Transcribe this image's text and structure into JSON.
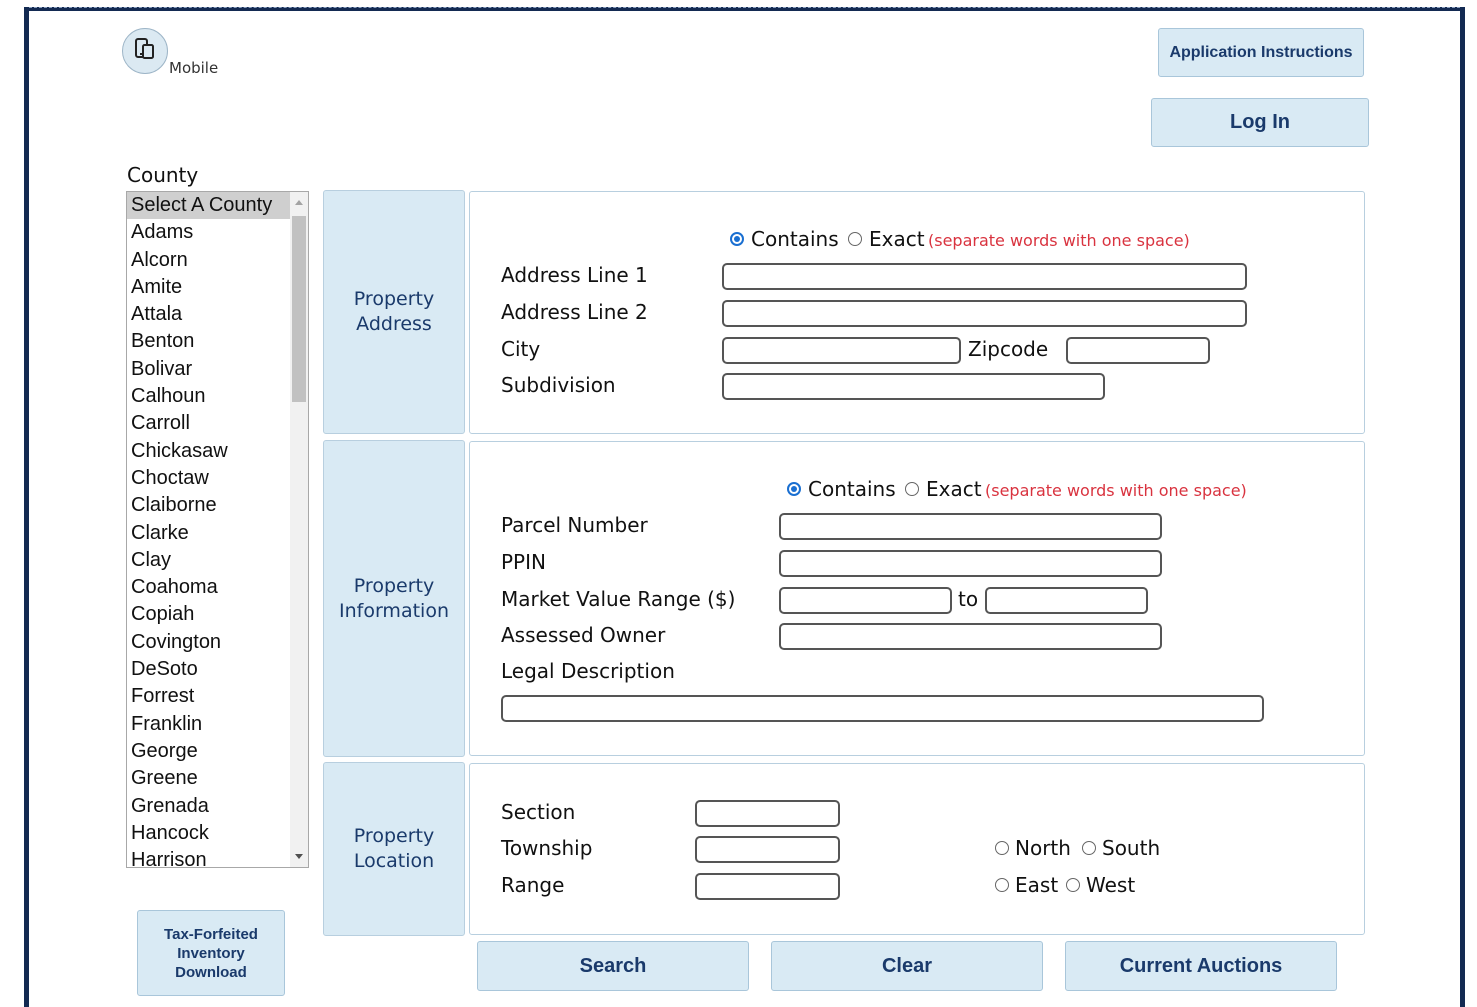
{
  "header": {
    "mobile_label": "Mobile",
    "app_instructions_label": "Application Instructions",
    "login_label": "Log In"
  },
  "county": {
    "label": "County",
    "options": [
      "Select A County",
      "Adams",
      "Alcorn",
      "Amite",
      "Attala",
      "Benton",
      "Bolivar",
      "Calhoun",
      "Carroll",
      "Chickasaw",
      "Choctaw",
      "Claiborne",
      "Clarke",
      "Clay",
      "Coahoma",
      "Copiah",
      "Covington",
      "DeSoto",
      "Forrest",
      "Franklin",
      "George",
      "Greene",
      "Grenada",
      "Hancock",
      "Harrison"
    ],
    "selected": "Select A County"
  },
  "tax_forfeited_label": "Tax-Forfeited Inventory Download",
  "address": {
    "section_label": "Property Address",
    "contains_label": "Contains",
    "exact_label": "Exact",
    "hint": "(separate words with one space)",
    "line1_label": "Address Line 1",
    "line2_label": "Address Line 2",
    "city_label": "City",
    "zipcode_label": "Zipcode",
    "subdivision_label": "Subdivision"
  },
  "info": {
    "section_label": "Property Information",
    "contains_label": "Contains",
    "exact_label": "Exact",
    "hint": "(separate words with one space)",
    "parcel_label": "Parcel Number",
    "ppin_label": "PPIN",
    "market_label": "Market Value Range ($)",
    "to_label": "to",
    "owner_label": "Assessed Owner",
    "legal_label": "Legal Description"
  },
  "location": {
    "section_label": "Property Location",
    "section_field_label": "Section",
    "township_label": "Township",
    "range_label": "Range",
    "north_label": "North",
    "south_label": "South",
    "east_label": "East",
    "west_label": "West"
  },
  "actions": {
    "search_label": "Search",
    "clear_label": "Clear",
    "auctions_label": "Current Auctions"
  },
  "colors": {
    "frame": "#132a52",
    "button_bg": "#d9eaf4",
    "button_text": "#1a3a6b",
    "hint_red": "#d9333f",
    "radio_blue": "#1a6fd1"
  }
}
